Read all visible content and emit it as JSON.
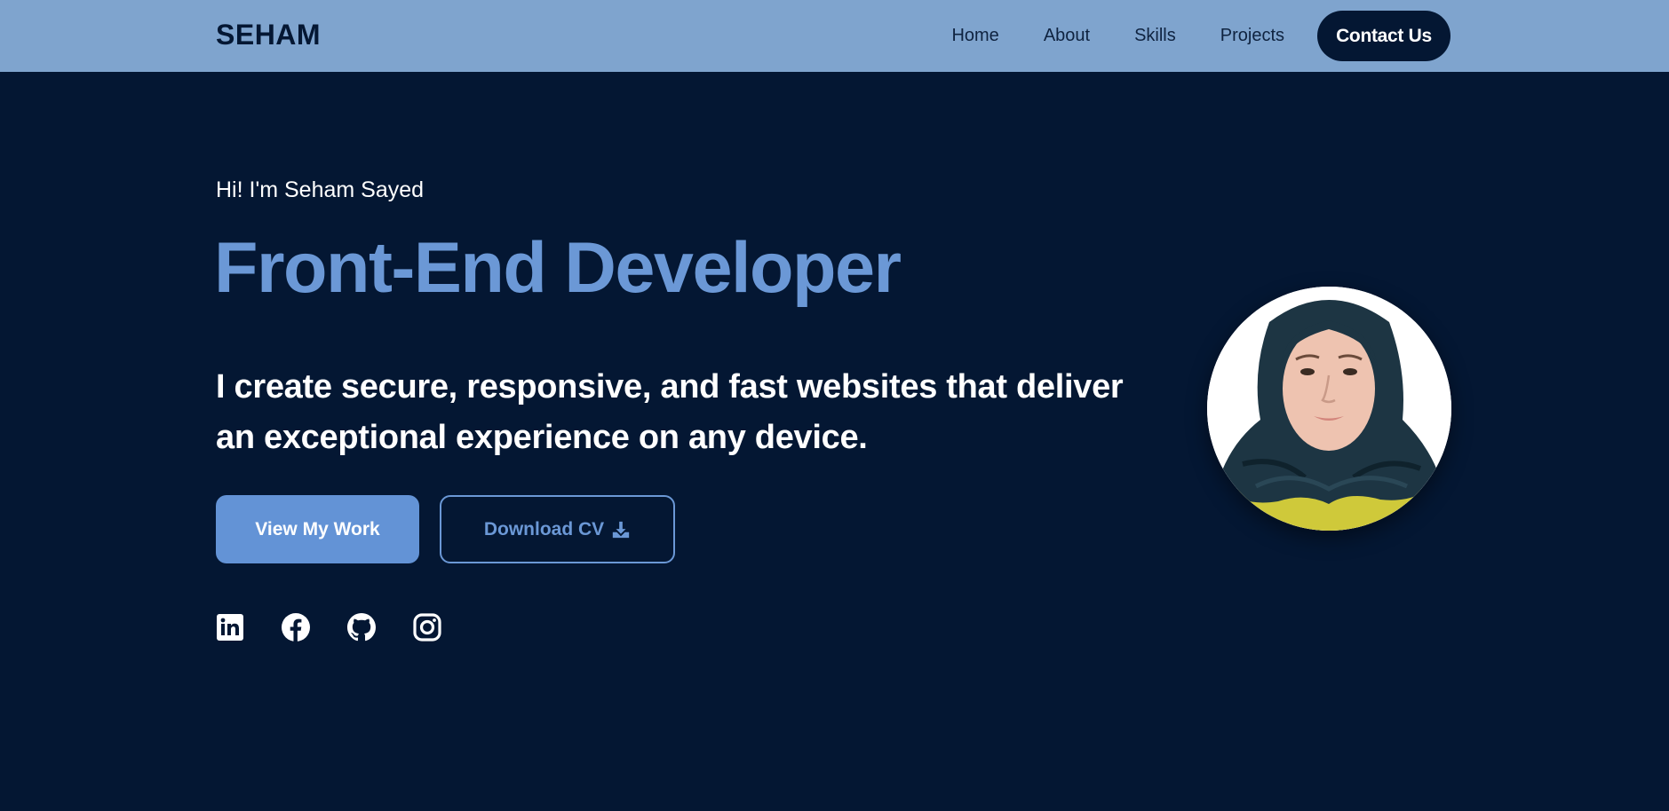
{
  "colors": {
    "background": "#041733",
    "navbar": "#7fa4ce",
    "accent": "#6b98d6",
    "button_primary": "#6393d6",
    "text": "#ffffff"
  },
  "header": {
    "brand": "SEHAM",
    "nav": [
      {
        "label": "Home"
      },
      {
        "label": "About"
      },
      {
        "label": "Skills"
      },
      {
        "label": "Projects"
      }
    ],
    "contact_label": "Contact Us"
  },
  "hero": {
    "greeting": "Hi! I'm Seham Sayed",
    "title": "Front-End Developer",
    "description": "I create secure, responsive, and fast websites that deliver an exceptional experience on any device.",
    "primary_button": "View My Work",
    "secondary_button": "Download CV",
    "secondary_icon": "download-icon",
    "socials": [
      {
        "icon": "linkedin-icon"
      },
      {
        "icon": "facebook-icon"
      },
      {
        "icon": "github-icon"
      },
      {
        "icon": "instagram-icon"
      }
    ],
    "avatar": "profile-photo"
  }
}
